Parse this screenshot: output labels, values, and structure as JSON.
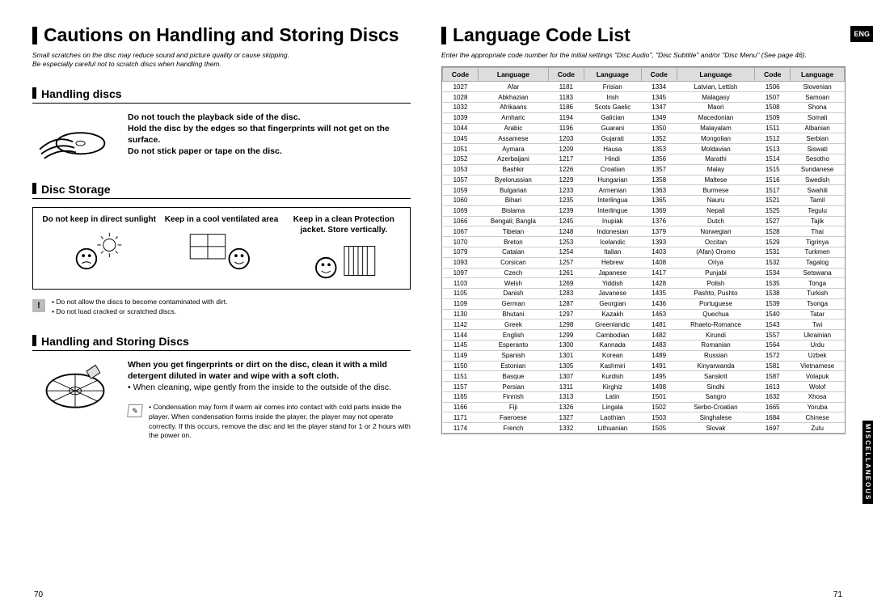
{
  "left": {
    "title": "Cautions on Handling and Storing Discs",
    "note1": "Small scratches on the disc may reduce sound and picture quality or cause skipping.",
    "note2": "Be especially careful not to scratch discs when handling them.",
    "handling": {
      "heading": "Handling discs",
      "l1": "Do not touch the playback side of the disc.",
      "l2": "Hold the disc by the edges so that fingerprints will not get on the surface.",
      "l3": "Do not stick paper or tape on the disc."
    },
    "storage": {
      "heading": "Disc Storage",
      "a": "Do not keep in direct sunlight",
      "b": "Keep in a cool ventilated area",
      "c": "Keep in a clean Protection jacket. Store vertically."
    },
    "warn1": "• Do not allow the discs to become contaminated with dirt.",
    "warn2": "• Do not load cracked or scratched discs.",
    "handling2": {
      "heading": "Handling and Storing Discs",
      "l1": "When you get fingerprints or dirt on the disc, clean it with a mild detergent diluted in water and wipe with a soft cloth.",
      "l2": "• When cleaning, wipe gently from the inside to the outside of the disc.",
      "tip": "• Condensation may form if warm air comes into contact with cold parts inside the player. When condensation forms inside the player, the player may not operate correctly. If this occurs, remove the disc and let the player stand for 1 or 2 hours with the power on."
    },
    "page": "70"
  },
  "right": {
    "title": "Language Code List",
    "eng": "ENG",
    "misc": "MISCELLANEOUS",
    "note": "Enter the appropriate code number for the initial settings \"Disc Audio\", \"Disc Subtitle\" and/or \"Disc Menu\" (See page 46).",
    "headers": [
      "Code",
      "Language",
      "Code",
      "Language",
      "Code",
      "Language",
      "Code",
      "Language"
    ],
    "rows": [
      [
        "1027",
        "Afar",
        "1181",
        "Frisian",
        "1334",
        "Latvian, Lettish",
        "1506",
        "Slovenian"
      ],
      [
        "1028",
        "Abkhazian",
        "1183",
        "Irish",
        "1345",
        "Malagasy",
        "1507",
        "Samoan"
      ],
      [
        "1032",
        "Afrikaans",
        "1186",
        "Scots Gaelic",
        "1347",
        "Maori",
        "1508",
        "Shona"
      ],
      [
        "1039",
        "Amharic",
        "1194",
        "Galician",
        "1349",
        "Macedonian",
        "1509",
        "Somali"
      ],
      [
        "1044",
        "Arabic",
        "1196",
        "Guarani",
        "1350",
        "Malayalam",
        "1511",
        "Albanian"
      ],
      [
        "1045",
        "Assamese",
        "1203",
        "Gujarati",
        "1352",
        "Mongolian",
        "1512",
        "Serbian"
      ],
      [
        "1051",
        "Aymara",
        "1209",
        "Hausa",
        "1353",
        "Moldavian",
        "1513",
        "Siswati"
      ],
      [
        "1052",
        "Azerbaijani",
        "1217",
        "Hindi",
        "1356",
        "Marathi",
        "1514",
        "Sesotho"
      ],
      [
        "1053",
        "Bashkir",
        "1226",
        "Croatian",
        "1357",
        "Malay",
        "1515",
        "Sundanese"
      ],
      [
        "1057",
        "Byelorussian",
        "1229",
        "Hungarian",
        "1358",
        "Maltese",
        "1516",
        "Swedish"
      ],
      [
        "1059",
        "Bulgarian",
        "1233",
        "Armenian",
        "1363",
        "Burmese",
        "1517",
        "Swahili"
      ],
      [
        "1060",
        "Bihari",
        "1235",
        "Interlingua",
        "1365",
        "Nauru",
        "1521",
        "Tamil"
      ],
      [
        "1069",
        "Bislama",
        "1239",
        "Interlingue",
        "1369",
        "Nepali",
        "1525",
        "Tegulu"
      ],
      [
        "1066",
        "Bengali; Bangla",
        "1245",
        "Inupiak",
        "1376",
        "Dutch",
        "1527",
        "Tajik"
      ],
      [
        "1067",
        "Tibetan",
        "1248",
        "Indonesian",
        "1379",
        "Norwegian",
        "1528",
        "Thai"
      ],
      [
        "1070",
        "Breton",
        "1253",
        "Icelandic",
        "1393",
        "Occitan",
        "1529",
        "Tigrinya"
      ],
      [
        "1079",
        "Catalan",
        "1254",
        "Italian",
        "1403",
        "(Afan) Oromo",
        "1531",
        "Turkmen"
      ],
      [
        "1093",
        "Corsican",
        "1257",
        "Hebrew",
        "1408",
        "Oriya",
        "1532",
        "Tagalog"
      ],
      [
        "1097",
        "Czech",
        "1261",
        "Japanese",
        "1417",
        "Punjabi",
        "1534",
        "Setswana"
      ],
      [
        "1103",
        "Welsh",
        "1269",
        "Yiddish",
        "1428",
        "Polish",
        "1535",
        "Tonga"
      ],
      [
        "1105",
        "Danish",
        "1283",
        "Javanese",
        "1435",
        "Pashto, Pushto",
        "1538",
        "Turkish"
      ],
      [
        "1109",
        "German",
        "1287",
        "Georgian",
        "1436",
        "Portuguese",
        "1539",
        "Tsonga"
      ],
      [
        "1130",
        "Bhutani",
        "1297",
        "Kazakh",
        "1463",
        "Quechua",
        "1540",
        "Tatar"
      ],
      [
        "1142",
        "Greek",
        "1298",
        "Greenlandic",
        "1481",
        "Rhaeto-Romance",
        "1543",
        "Twi"
      ],
      [
        "1144",
        "English",
        "1299",
        "Cambodian",
        "1482",
        "Kirundi",
        "1557",
        "Ukrainian"
      ],
      [
        "1145",
        "Esperanto",
        "1300",
        "Kannada",
        "1483",
        "Romanian",
        "1564",
        "Urdu"
      ],
      [
        "1149",
        "Spanish",
        "1301",
        "Korean",
        "1489",
        "Russian",
        "1572",
        "Uzbek"
      ],
      [
        "1150",
        "Estonian",
        "1305",
        "Kashmiri",
        "1491",
        "Kinyarwanda",
        "1581",
        "Vietnamese"
      ],
      [
        "1151",
        "Basque",
        "1307",
        "Kurdish",
        "1495",
        "Sanskrit",
        "1587",
        "Volapuk"
      ],
      [
        "1157",
        "Persian",
        "1311",
        "Kirghiz",
        "1498",
        "Sindhi",
        "1613",
        "Wolof"
      ],
      [
        "1165",
        "Finnish",
        "1313",
        "Latin",
        "1501",
        "Sangro",
        "1632",
        "Xhosa"
      ],
      [
        "1166",
        "Fiji",
        "1326",
        "Lingala",
        "1502",
        "Serbo-Croatian",
        "1665",
        "Yoruba"
      ],
      [
        "1171",
        "Faeroese",
        "1327",
        "Laothian",
        "1503",
        "Singhalese",
        "1684",
        "Chinese"
      ],
      [
        "1174",
        "French",
        "1332",
        "Lithuanian",
        "1505",
        "Slovak",
        "1697",
        "Zulu"
      ]
    ],
    "page": "71"
  },
  "chart_data": {
    "type": "table",
    "title": "Language Code List",
    "columns": [
      "Code",
      "Language"
    ],
    "rows": [
      [
        1027,
        "Afar"
      ],
      [
        1028,
        "Abkhazian"
      ],
      [
        1032,
        "Afrikaans"
      ],
      [
        1039,
        "Amharic"
      ],
      [
        1044,
        "Arabic"
      ],
      [
        1045,
        "Assamese"
      ],
      [
        1051,
        "Aymara"
      ],
      [
        1052,
        "Azerbaijani"
      ],
      [
        1053,
        "Bashkir"
      ],
      [
        1057,
        "Byelorussian"
      ],
      [
        1059,
        "Bulgarian"
      ],
      [
        1060,
        "Bihari"
      ],
      [
        1066,
        "Bengali; Bangla"
      ],
      [
        1067,
        "Tibetan"
      ],
      [
        1069,
        "Bislama"
      ],
      [
        1070,
        "Breton"
      ],
      [
        1079,
        "Catalan"
      ],
      [
        1093,
        "Corsican"
      ],
      [
        1097,
        "Czech"
      ],
      [
        1103,
        "Welsh"
      ],
      [
        1105,
        "Danish"
      ],
      [
        1109,
        "German"
      ],
      [
        1130,
        "Bhutani"
      ],
      [
        1142,
        "Greek"
      ],
      [
        1144,
        "English"
      ],
      [
        1145,
        "Esperanto"
      ],
      [
        1149,
        "Spanish"
      ],
      [
        1150,
        "Estonian"
      ],
      [
        1151,
        "Basque"
      ],
      [
        1157,
        "Persian"
      ],
      [
        1165,
        "Finnish"
      ],
      [
        1166,
        "Fiji"
      ],
      [
        1171,
        "Faeroese"
      ],
      [
        1174,
        "French"
      ],
      [
        1181,
        "Frisian"
      ],
      [
        1183,
        "Irish"
      ],
      [
        1186,
        "Scots Gaelic"
      ],
      [
        1194,
        "Galician"
      ],
      [
        1196,
        "Guarani"
      ],
      [
        1203,
        "Gujarati"
      ],
      [
        1209,
        "Hausa"
      ],
      [
        1217,
        "Hindi"
      ],
      [
        1226,
        "Croatian"
      ],
      [
        1229,
        "Hungarian"
      ],
      [
        1233,
        "Armenian"
      ],
      [
        1235,
        "Interlingua"
      ],
      [
        1239,
        "Interlingue"
      ],
      [
        1245,
        "Inupiak"
      ],
      [
        1248,
        "Indonesian"
      ],
      [
        1253,
        "Icelandic"
      ],
      [
        1254,
        "Italian"
      ],
      [
        1257,
        "Hebrew"
      ],
      [
        1261,
        "Japanese"
      ],
      [
        1269,
        "Yiddish"
      ],
      [
        1283,
        "Javanese"
      ],
      [
        1287,
        "Georgian"
      ],
      [
        1297,
        "Kazakh"
      ],
      [
        1298,
        "Greenlandic"
      ],
      [
        1299,
        "Cambodian"
      ],
      [
        1300,
        "Kannada"
      ],
      [
        1301,
        "Korean"
      ],
      [
        1305,
        "Kashmiri"
      ],
      [
        1307,
        "Kurdish"
      ],
      [
        1311,
        "Kirghiz"
      ],
      [
        1313,
        "Latin"
      ],
      [
        1326,
        "Lingala"
      ],
      [
        1327,
        "Laothian"
      ],
      [
        1332,
        "Lithuanian"
      ],
      [
        1334,
        "Latvian, Lettish"
      ],
      [
        1345,
        "Malagasy"
      ],
      [
        1347,
        "Maori"
      ],
      [
        1349,
        "Macedonian"
      ],
      [
        1350,
        "Malayalam"
      ],
      [
        1352,
        "Mongolian"
      ],
      [
        1353,
        "Moldavian"
      ],
      [
        1356,
        "Marathi"
      ],
      [
        1357,
        "Malay"
      ],
      [
        1358,
        "Maltese"
      ],
      [
        1363,
        "Burmese"
      ],
      [
        1365,
        "Nauru"
      ],
      [
        1369,
        "Nepali"
      ],
      [
        1376,
        "Dutch"
      ],
      [
        1379,
        "Norwegian"
      ],
      [
        1393,
        "Occitan"
      ],
      [
        1403,
        "(Afan) Oromo"
      ],
      [
        1408,
        "Oriya"
      ],
      [
        1417,
        "Punjabi"
      ],
      [
        1428,
        "Polish"
      ],
      [
        1435,
        "Pashto, Pushto"
      ],
      [
        1436,
        "Portuguese"
      ],
      [
        1463,
        "Quechua"
      ],
      [
        1481,
        "Rhaeto-Romance"
      ],
      [
        1482,
        "Kirundi"
      ],
      [
        1483,
        "Romanian"
      ],
      [
        1489,
        "Russian"
      ],
      [
        1491,
        "Kinyarwanda"
      ],
      [
        1495,
        "Sanskrit"
      ],
      [
        1498,
        "Sindhi"
      ],
      [
        1501,
        "Sangro"
      ],
      [
        1502,
        "Serbo-Croatian"
      ],
      [
        1503,
        "Singhalese"
      ],
      [
        1505,
        "Slovak"
      ],
      [
        1506,
        "Slovenian"
      ],
      [
        1507,
        "Samoan"
      ],
      [
        1508,
        "Shona"
      ],
      [
        1509,
        "Somali"
      ],
      [
        1511,
        "Albanian"
      ],
      [
        1512,
        "Serbian"
      ],
      [
        1513,
        "Siswati"
      ],
      [
        1514,
        "Sesotho"
      ],
      [
        1515,
        "Sundanese"
      ],
      [
        1516,
        "Swedish"
      ],
      [
        1517,
        "Swahili"
      ],
      [
        1521,
        "Tamil"
      ],
      [
        1525,
        "Tegulu"
      ],
      [
        1527,
        "Tajik"
      ],
      [
        1528,
        "Thai"
      ],
      [
        1529,
        "Tigrinya"
      ],
      [
        1531,
        "Turkmen"
      ],
      [
        1532,
        "Tagalog"
      ],
      [
        1534,
        "Setswana"
      ],
      [
        1535,
        "Tonga"
      ],
      [
        1538,
        "Turkish"
      ],
      [
        1539,
        "Tsonga"
      ],
      [
        1540,
        "Tatar"
      ],
      [
        1543,
        "Twi"
      ],
      [
        1557,
        "Ukrainian"
      ],
      [
        1564,
        "Urdu"
      ],
      [
        1572,
        "Uzbek"
      ],
      [
        1581,
        "Vietnamese"
      ],
      [
        1587,
        "Volapuk"
      ],
      [
        1613,
        "Wolof"
      ],
      [
        1632,
        "Xhosa"
      ],
      [
        1665,
        "Yoruba"
      ],
      [
        1684,
        "Chinese"
      ],
      [
        1697,
        "Zulu"
      ]
    ]
  }
}
